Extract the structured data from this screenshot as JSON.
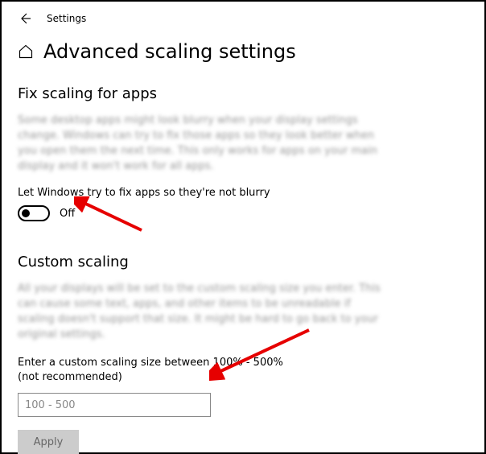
{
  "topbar": {
    "app_name": "Settings"
  },
  "header": {
    "title": "Advanced scaling settings"
  },
  "section_fix": {
    "heading": "Fix scaling for apps",
    "blurred_desc": "Some desktop apps might look blurry when your display settings change. Windows can try to fix those apps so they look better when you open them the next time. This only works for apps on your main display and it won't work for all apps.",
    "toggle_label": "Let Windows try to fix apps so they're not blurry",
    "toggle_state": "Off"
  },
  "section_custom": {
    "heading": "Custom scaling",
    "blurred_desc": "All your displays will be set to the custom scaling size you enter. This can cause some text, apps, and other items to be unreadable if scaling doesn't support that size. It might be hard to go back to your original settings.",
    "field_label": "Enter a custom scaling size between 100% - 500% (not recommended)",
    "placeholder": "100 - 500",
    "apply_label": "Apply"
  }
}
